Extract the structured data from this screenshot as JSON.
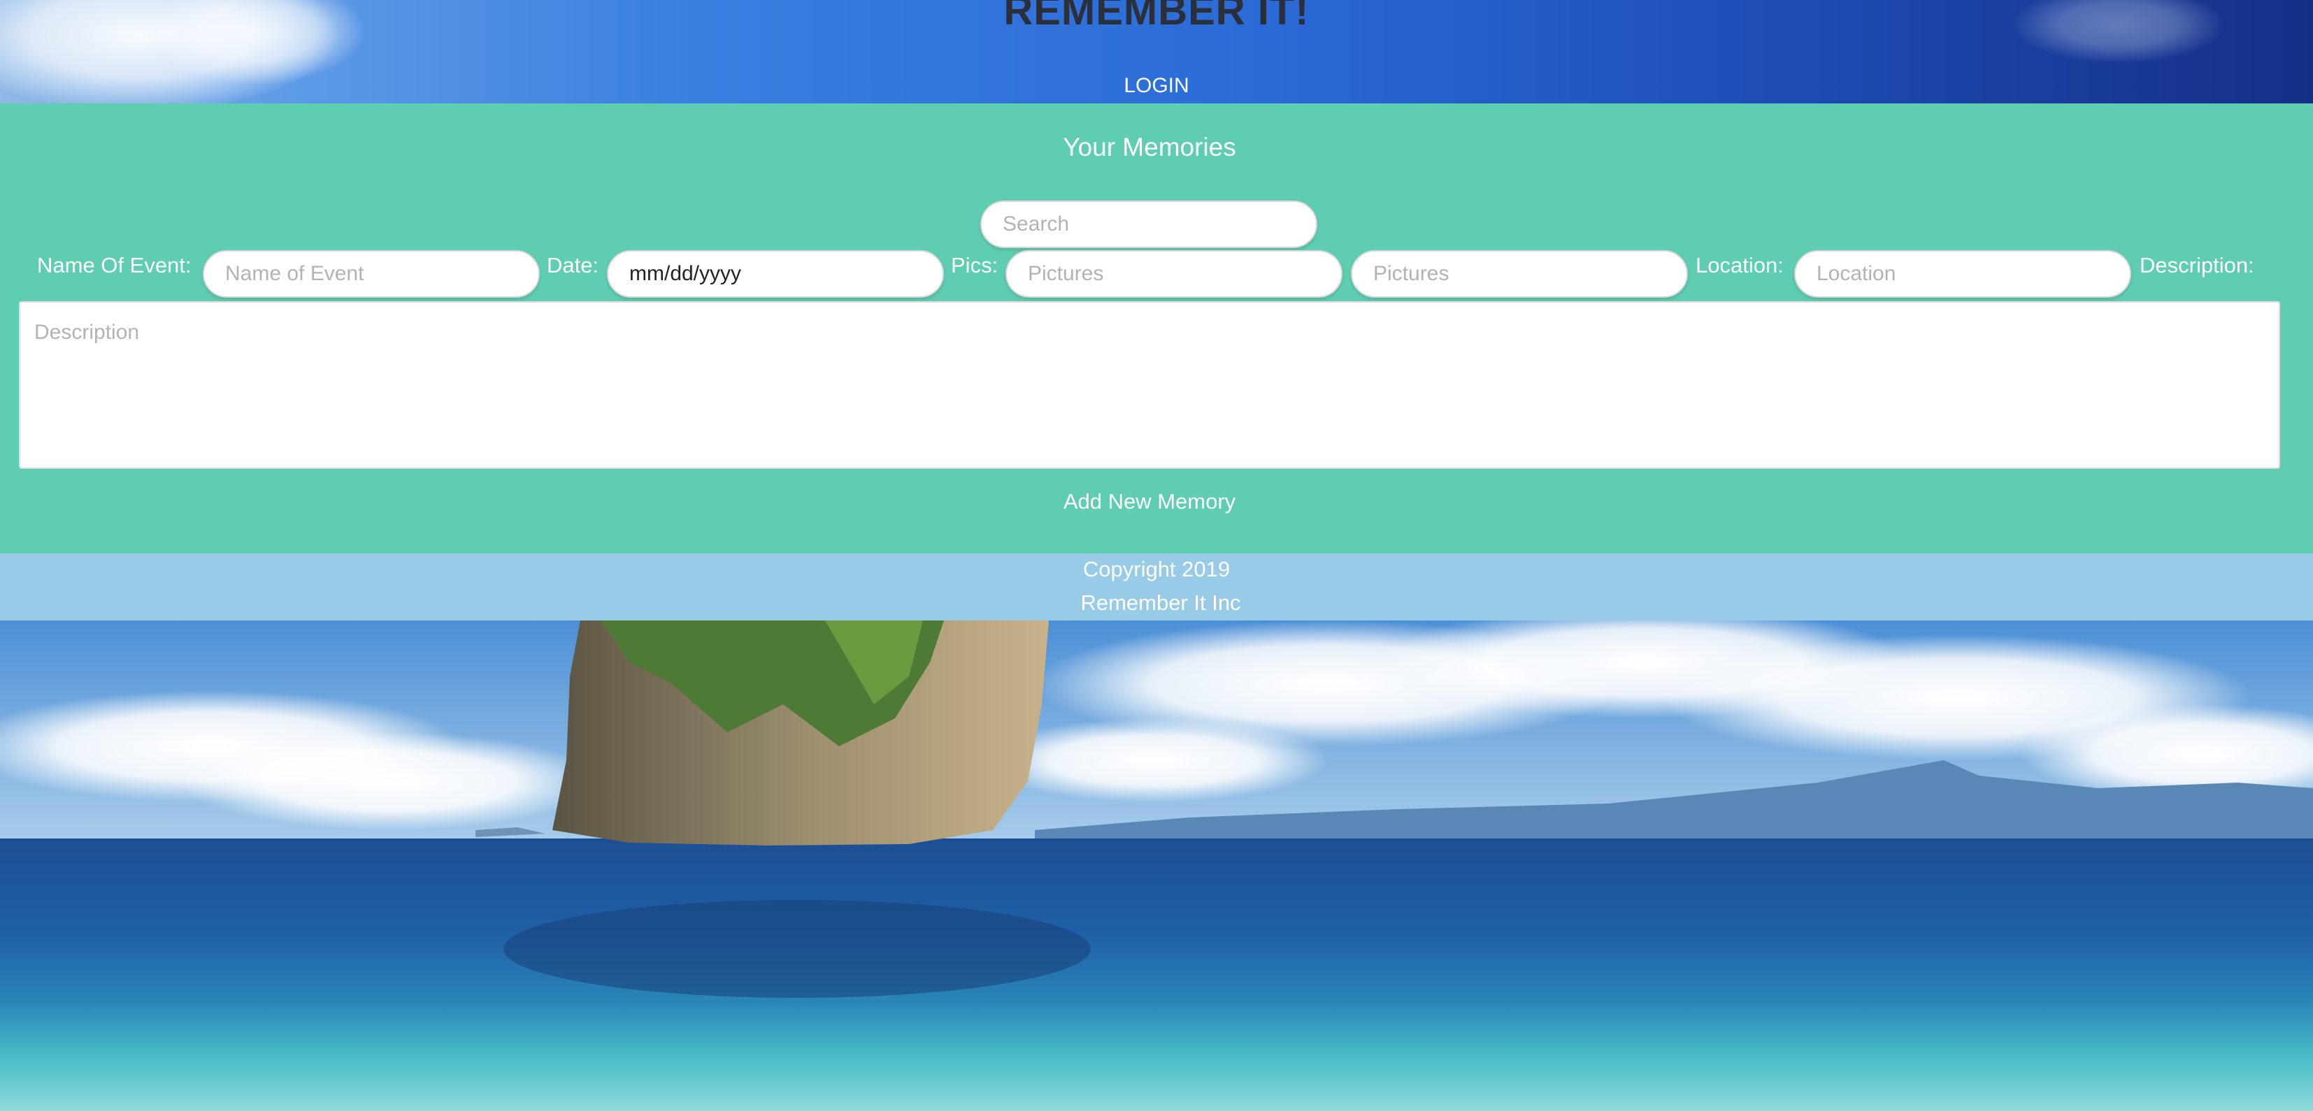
{
  "header": {
    "title": "REMEMBER IT!",
    "login_label": "LOGIN"
  },
  "memories": {
    "heading": "Your Memories",
    "search_placeholder": "Search",
    "labels": {
      "name": "Name Of Event:",
      "date": "Date:",
      "pics": "Pics:",
      "location": "Location:",
      "description": "Description:"
    },
    "placeholders": {
      "name": "Name of Event",
      "date": "mm/dd/yyyy",
      "picture1": "Pictures",
      "picture2": "Pictures",
      "location": "Location",
      "description": "Description"
    },
    "add_button": "Add New Memory"
  },
  "footer": {
    "line1": "Copyright 2019",
    "line2": "Remember It Inc"
  },
  "colors": {
    "header_sky": "#2a6ad6",
    "panel": "#5fcdb2",
    "footer": "#97cbe8",
    "title_text": "#2b2f3a"
  }
}
